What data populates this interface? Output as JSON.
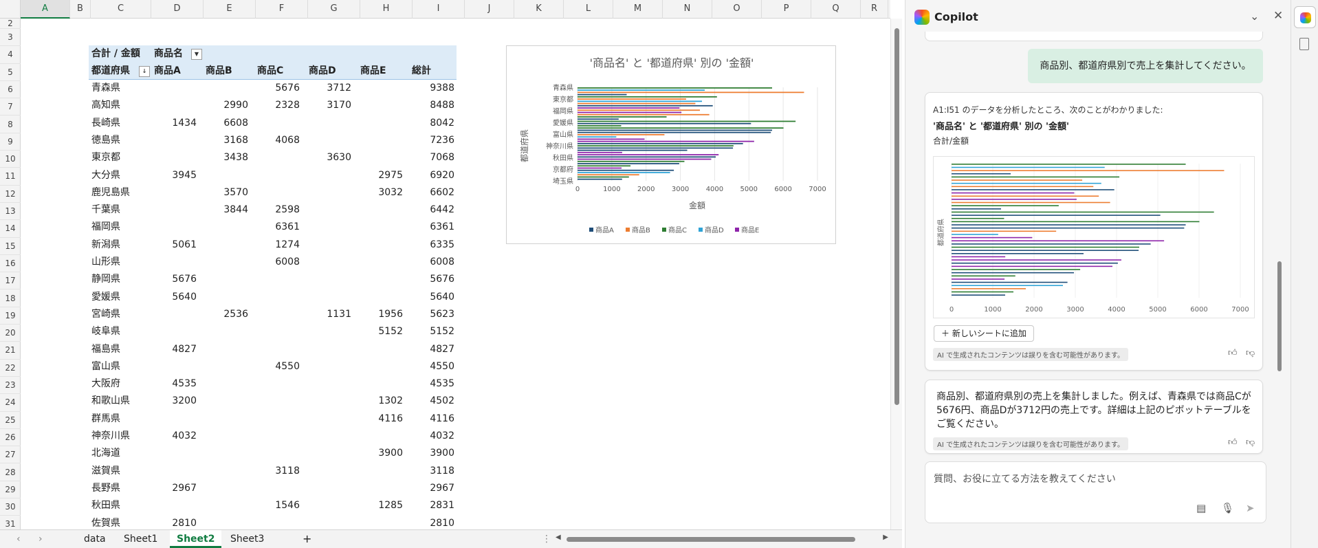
{
  "sheet": {
    "columns": [
      "A",
      "B",
      "C",
      "D",
      "E",
      "F",
      "G",
      "H",
      "I",
      "J",
      "K",
      "L",
      "M",
      "N",
      "O",
      "P",
      "Q",
      "R"
    ],
    "rows": [
      "2",
      "3",
      "4",
      "5",
      "6",
      "7",
      "8",
      "9",
      "10",
      "11",
      "12",
      "13",
      "14",
      "15",
      "16",
      "17",
      "18",
      "19",
      "20",
      "21",
      "22",
      "23",
      "24",
      "25",
      "26",
      "27",
      "28",
      "29",
      "30",
      "31"
    ],
    "selected_column": "A"
  },
  "pivot": {
    "value_label": "合計 / 金額",
    "column_field": "商品名",
    "row_field": "都道府県",
    "headers": [
      "商品A",
      "商品B",
      "商品C",
      "商品D",
      "商品E",
      "総計"
    ],
    "rows": [
      {
        "pref": "青森県",
        "a": "",
        "b": "",
        "c": "5676",
        "d": "3712",
        "e": "",
        "total": "9388"
      },
      {
        "pref": "高知県",
        "a": "",
        "b": "2990",
        "c": "2328",
        "d": "3170",
        "e": "",
        "total": "8488"
      },
      {
        "pref": "長崎県",
        "a": "1434",
        "b": "6608",
        "c": "",
        "d": "",
        "e": "",
        "total": "8042"
      },
      {
        "pref": "徳島県",
        "a": "",
        "b": "3168",
        "c": "4068",
        "d": "",
        "e": "",
        "total": "7236"
      },
      {
        "pref": "東京都",
        "a": "",
        "b": "3438",
        "c": "",
        "d": "3630",
        "e": "",
        "total": "7068"
      },
      {
        "pref": "大分県",
        "a": "3945",
        "b": "",
        "c": "",
        "d": "",
        "e": "2975",
        "total": "6920"
      },
      {
        "pref": "鹿児島県",
        "a": "",
        "b": "3570",
        "c": "",
        "d": "",
        "e": "3032",
        "total": "6602"
      },
      {
        "pref": "千葉県",
        "a": "",
        "b": "3844",
        "c": "2598",
        "d": "",
        "e": "",
        "total": "6442"
      },
      {
        "pref": "福岡県",
        "a": "",
        "b": "",
        "c": "6361",
        "d": "",
        "e": "",
        "total": "6361"
      },
      {
        "pref": "新潟県",
        "a": "5061",
        "b": "",
        "c": "1274",
        "d": "",
        "e": "",
        "total": "6335"
      },
      {
        "pref": "山形県",
        "a": "",
        "b": "",
        "c": "6008",
        "d": "",
        "e": "",
        "total": "6008"
      },
      {
        "pref": "静岡県",
        "a": "5676",
        "b": "",
        "c": "",
        "d": "",
        "e": "",
        "total": "5676"
      },
      {
        "pref": "愛媛県",
        "a": "5640",
        "b": "",
        "c": "",
        "d": "",
        "e": "",
        "total": "5640"
      },
      {
        "pref": "宮崎県",
        "a": "",
        "b": "2536",
        "c": "",
        "d": "1131",
        "e": "1956",
        "total": "5623"
      },
      {
        "pref": "岐阜県",
        "a": "",
        "b": "",
        "c": "",
        "d": "",
        "e": "5152",
        "total": "5152"
      },
      {
        "pref": "福島県",
        "a": "4827",
        "b": "",
        "c": "",
        "d": "",
        "e": "",
        "total": "4827"
      },
      {
        "pref": "富山県",
        "a": "",
        "b": "",
        "c": "4550",
        "d": "",
        "e": "",
        "total": "4550"
      },
      {
        "pref": "大阪府",
        "a": "4535",
        "b": "",
        "c": "",
        "d": "",
        "e": "",
        "total": "4535"
      },
      {
        "pref": "和歌山県",
        "a": "3200",
        "b": "",
        "c": "",
        "d": "",
        "e": "1302",
        "total": "4502"
      },
      {
        "pref": "群馬県",
        "a": "",
        "b": "",
        "c": "",
        "d": "",
        "e": "4116",
        "total": "4116"
      },
      {
        "pref": "神奈川県",
        "a": "4032",
        "b": "",
        "c": "",
        "d": "",
        "e": "",
        "total": "4032"
      },
      {
        "pref": "北海道",
        "a": "",
        "b": "",
        "c": "",
        "d": "",
        "e": "3900",
        "total": "3900"
      },
      {
        "pref": "滋賀県",
        "a": "",
        "b": "",
        "c": "3118",
        "d": "",
        "e": "",
        "total": "3118"
      },
      {
        "pref": "長野県",
        "a": "2967",
        "b": "",
        "c": "",
        "d": "",
        "e": "",
        "total": "2967"
      },
      {
        "pref": "秋田県",
        "a": "",
        "b": "",
        "c": "1546",
        "d": "",
        "e": "1285",
        "total": "2831"
      },
      {
        "pref": "佐賀県",
        "a": "2810",
        "b": "",
        "c": "",
        "d": "",
        "e": "",
        "total": "2810"
      }
    ]
  },
  "chart_data": {
    "type": "bar",
    "title": "'商品名' と '都道府県' 別の '金額'",
    "xlabel": "金額",
    "ylabel": "都道府県",
    "xlim": [
      0,
      7000
    ],
    "xticks": [
      "0",
      "1000",
      "2000",
      "3000",
      "4000",
      "5000",
      "6000",
      "7000"
    ],
    "yticks": [
      "青森県",
      "東京都",
      "福岡県",
      "愛媛県",
      "富山県",
      "神奈川県",
      "秋田県",
      "京都府",
      "埼玉県"
    ],
    "legend": [
      "商品A",
      "商品B",
      "商品C",
      "商品D",
      "商品E"
    ],
    "legend_position": "bottom",
    "colors": {
      "商品A": "#1f4e79",
      "商品B": "#ed7d31",
      "商品C": "#2e7d32",
      "商品D": "#2fa3d6",
      "商品E": "#8e24aa"
    },
    "bars": [
      {
        "s": "C",
        "v": 5676
      },
      {
        "s": "D",
        "v": 3712
      },
      {
        "s": "B",
        "v": 6608
      },
      {
        "s": "A",
        "v": 1434
      },
      {
        "s": "C",
        "v": 4068
      },
      {
        "s": "B",
        "v": 3168
      },
      {
        "s": "D",
        "v": 3630
      },
      {
        "s": "B",
        "v": 3438
      },
      {
        "s": "A",
        "v": 3945
      },
      {
        "s": "E",
        "v": 2975
      },
      {
        "s": "B",
        "v": 3570
      },
      {
        "s": "E",
        "v": 3032
      },
      {
        "s": "B",
        "v": 3844
      },
      {
        "s": "C",
        "v": 2598
      },
      {
        "s": "A",
        "v": 1200
      },
      {
        "s": "C",
        "v": 6361
      },
      {
        "s": "A",
        "v": 5061
      },
      {
        "s": "C",
        "v": 1274
      },
      {
        "s": "C",
        "v": 6008
      },
      {
        "s": "A",
        "v": 5676
      },
      {
        "s": "A",
        "v": 5640
      },
      {
        "s": "B",
        "v": 2536
      },
      {
        "s": "D",
        "v": 1131
      },
      {
        "s": "E",
        "v": 1956
      },
      {
        "s": "E",
        "v": 5152
      },
      {
        "s": "A",
        "v": 4827
      },
      {
        "s": "C",
        "v": 4550
      },
      {
        "s": "A",
        "v": 4535
      },
      {
        "s": "A",
        "v": 3200
      },
      {
        "s": "E",
        "v": 1302
      },
      {
        "s": "E",
        "v": 4116
      },
      {
        "s": "A",
        "v": 4032
      },
      {
        "s": "E",
        "v": 3900
      },
      {
        "s": "C",
        "v": 3118
      },
      {
        "s": "A",
        "v": 2967
      },
      {
        "s": "C",
        "v": 1546
      },
      {
        "s": "E",
        "v": 1285
      },
      {
        "s": "A",
        "v": 2810
      },
      {
        "s": "D",
        "v": 2700
      },
      {
        "s": "B",
        "v": 1800
      },
      {
        "s": "C",
        "v": 1500
      },
      {
        "s": "A",
        "v": 1300
      }
    ]
  },
  "tabs": {
    "items": [
      "data",
      "Sheet1",
      "Sheet2",
      "Sheet3"
    ],
    "active": "Sheet2",
    "add_label": "+",
    "prev": "‹",
    "next": "›",
    "more": "⋮"
  },
  "copilot": {
    "title": "Copilot",
    "user_message": "商品別、都道府県別で売上を集計してください。",
    "card1": {
      "intro": "A1:I51 のデータを分析したところ、次のことがわかりました:",
      "heading": "'商品名' と '都道府県' 別の '金額'",
      "sub": "合計/金額",
      "mini_ylabel": "都道府県",
      "mini_xticks": [
        "0",
        "1000",
        "2000",
        "3000",
        "4000",
        "5000",
        "6000",
        "7000"
      ],
      "add_button": "新しいシートに追加",
      "disclaimer": "AI で生成されたコンテンツは誤りを含む可能性があります。"
    },
    "card2": {
      "text": "商品別、都道府県別の売上を集計しました。例えば、青森県では商品Cが5676円、商品Dが3712円の売上です。詳細は上記のピボットテーブルをご覧ください。",
      "disclaimer": "AI で生成されたコンテンツは誤りを含む可能性があります。"
    },
    "input_placeholder": "質問、お役に立てる方法を教えてください"
  }
}
